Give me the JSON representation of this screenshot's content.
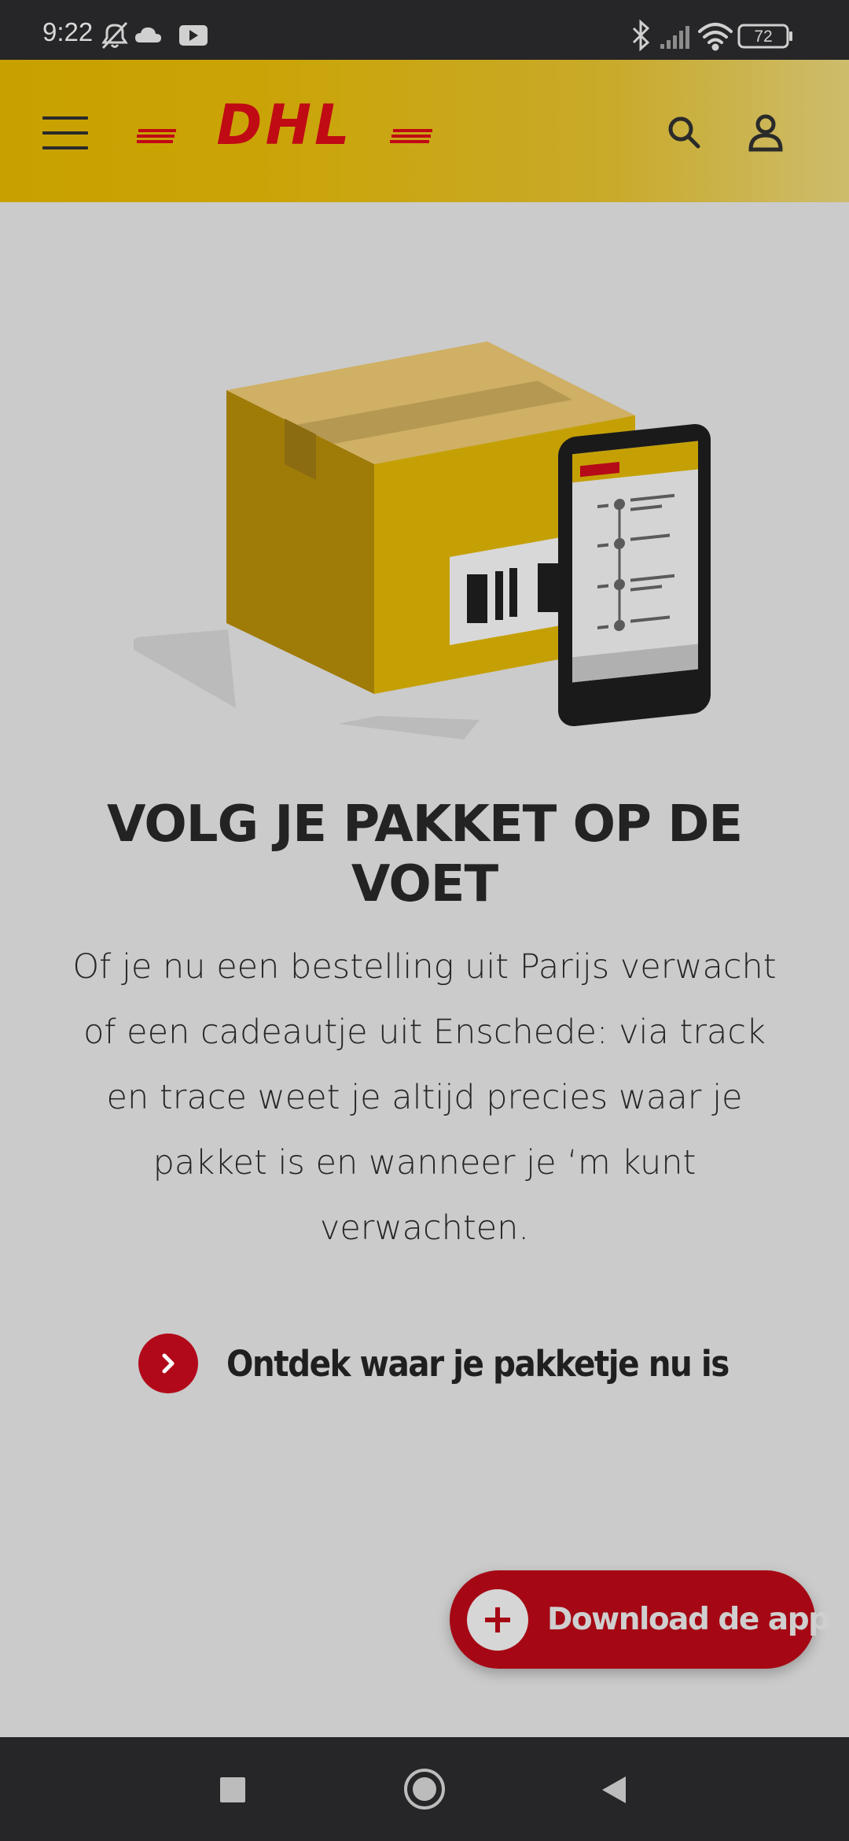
{
  "status_bar": {
    "time": "9:22",
    "battery": "72",
    "left_icons": [
      "bell-off-icon",
      "cloud-icon",
      "youtube-icon"
    ],
    "right_icons": [
      "bluetooth-icon",
      "signal-icon",
      "wifi-icon",
      "battery-icon"
    ]
  },
  "header": {
    "logo_text": "DHL",
    "icons": [
      "menu-icon",
      "search-icon",
      "user-icon"
    ],
    "brand_color": "#c8a100",
    "logo_color": "#c00a14"
  },
  "hero": {
    "title": "VOLG JE PAKKET OP DE VOET",
    "description": "Of je nu een bestelling uit Parijs verwacht of een cadeautje uit Enschede: via track en trace weet je altijd precies waar je pakket is en wanneer je ‘m kunt verwachten.",
    "cta_label": "Ontdek waar je pakketje nu is",
    "cta_icon": "chevron-right-icon"
  },
  "download_button": {
    "label": "Download de app",
    "icon": "plus-icon",
    "color": "#a50814"
  },
  "nav_bar": {
    "icons": [
      "recent-apps-icon",
      "home-icon",
      "back-icon"
    ]
  }
}
